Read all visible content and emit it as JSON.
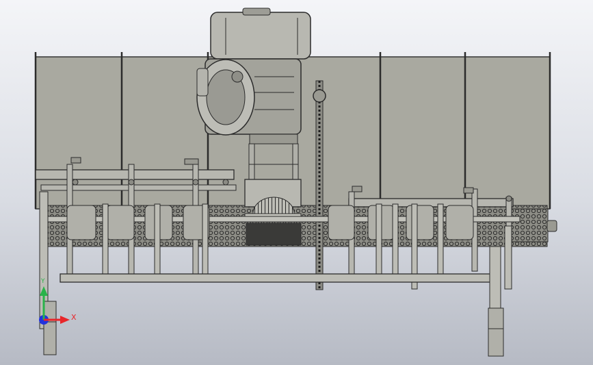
{
  "viewport": {
    "background_top": "#f4f5f8",
    "background_bottom": "#b6bac4"
  },
  "model": {
    "part_color": "#aeaea5",
    "panel_color": "#a9a9a0",
    "edge_color": "#2b2b2b",
    "dark_color": "#3a3a38"
  },
  "triad": {
    "x_label": "X",
    "y_label": "Y",
    "x_color": "#e8262a",
    "y_color": "#2ab34a",
    "z_color": "#2233dd"
  }
}
